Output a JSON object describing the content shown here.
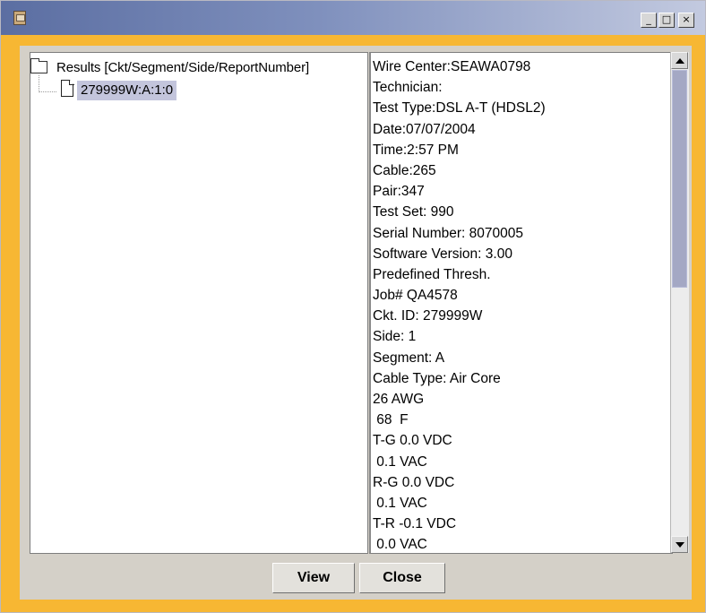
{
  "window": {
    "title": "",
    "controls": {
      "minimize": "_",
      "maximize": "□",
      "close": "×"
    }
  },
  "tree": {
    "root_label": "Results [Ckt/Segment/Side/ReportNumber]",
    "items": [
      {
        "label": "279999W:A:1:0",
        "selected": true
      }
    ]
  },
  "details": {
    "lines": [
      "Wire Center:SEAWA0798",
      "Technician:",
      "Test Type:DSL A-T (HDSL2)",
      "Date:07/07/2004",
      "Time:2:57 PM",
      "Cable:265",
      "Pair:347",
      "Test Set: 990",
      "Serial Number: 8070005",
      "Software Version: 3.00",
      "Predefined Thresh.",
      "Job# QA4578",
      "Ckt. ID: 279999W",
      "Side: 1",
      "Segment: A",
      "Cable Type: Air Core",
      "26 AWG",
      " 68  F",
      "T-G 0.0 VDC",
      " 0.1 VAC",
      "R-G 0.0 VDC",
      " 0.1 VAC",
      "T-R -0.1 VDC",
      " 0.0 VAC"
    ]
  },
  "buttons": {
    "view": "View",
    "close": "Close"
  },
  "colors": {
    "frame": "#f7b733",
    "selection": "#c3c5dc",
    "scroll_thumb": "#a4a8c4"
  },
  "icons": {
    "app": "app-icon",
    "folder": "folder-icon",
    "file": "file-icon"
  }
}
